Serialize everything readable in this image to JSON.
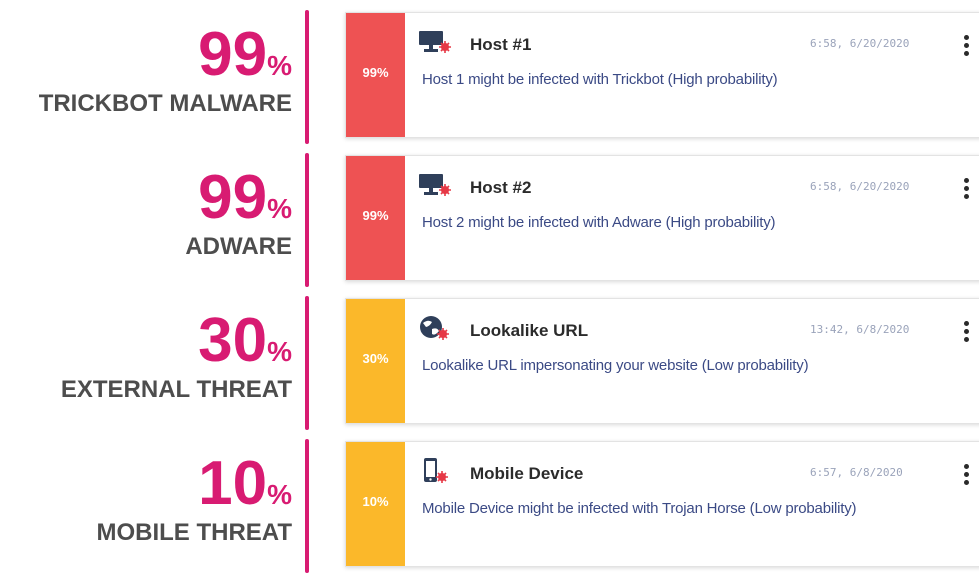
{
  "colors": {
    "accent": "#d81b72",
    "high": "#ee5253",
    "low": "#fbb82a",
    "description": "#3b4a85"
  },
  "stats": [
    {
      "value": "99",
      "unit": "%",
      "label": "TRICKBOT MALWARE"
    },
    {
      "value": "99",
      "unit": "%",
      "label": "ADWARE"
    },
    {
      "value": "30",
      "unit": "%",
      "label": "EXTERNAL THREAT"
    },
    {
      "value": "10",
      "unit": "%",
      "label": "MOBILE THREAT"
    }
  ],
  "alerts": [
    {
      "score": "99%",
      "severity": "high",
      "icon": "infected-host-icon",
      "title": "Host #1",
      "time": "6:58, 6/20/2020",
      "description": "Host 1 might be infected with Trickbot (High probability)"
    },
    {
      "score": "99%",
      "severity": "high",
      "icon": "infected-host-icon",
      "title": "Host #2",
      "time": "6:58, 6/20/2020",
      "description": "Host 2 might be infected with Adware (High probability)"
    },
    {
      "score": "30%",
      "severity": "low",
      "icon": "globe-threat-icon",
      "title": "Lookalike URL",
      "time": "13:42, 6/8/2020",
      "description": "Lookalike URL impersonating your website (Low probability)"
    },
    {
      "score": "10%",
      "severity": "low",
      "icon": "mobile-threat-icon",
      "title": "Mobile Device",
      "time": "6:57, 6/8/2020",
      "description": "Mobile Device might be infected with Trojan Horse (Low probability)"
    }
  ]
}
